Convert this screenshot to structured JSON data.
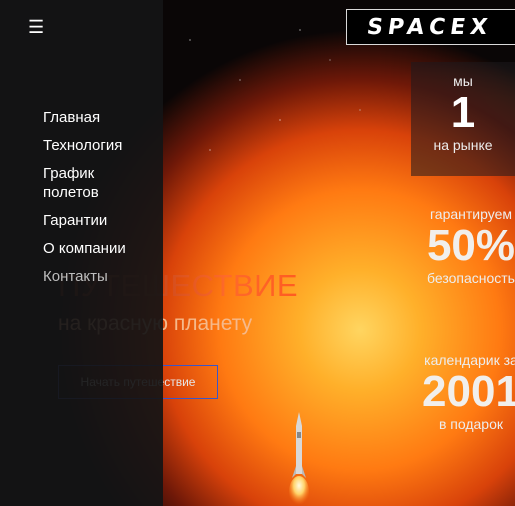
{
  "menu": {
    "hamburger": "☰",
    "items": [
      "Главная",
      "Технология",
      "График полетов",
      "Гарантии",
      "О компании",
      "Контакты"
    ]
  },
  "header": {
    "logo": "SPACEX"
  },
  "hero": {
    "title": "ПУТЕШЕСТВИЕ",
    "subtitle": "на красную планету",
    "button": "Начать путешествие"
  },
  "stats": [
    {
      "top": "мы",
      "value": "1",
      "bottom": "на рынке"
    },
    {
      "top": "гарантируем",
      "value": "50%",
      "bottom": "безопасность"
    },
    {
      "top": "календарик за",
      "value": "2001",
      "bottom": "в подарок"
    }
  ],
  "colors": {
    "accent": "#ff5b22",
    "button_border": "#3b56c9",
    "sidebar": "#141416"
  }
}
